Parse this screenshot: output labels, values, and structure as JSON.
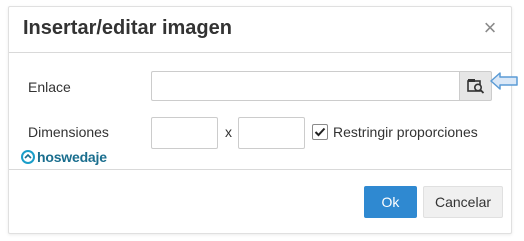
{
  "dialog": {
    "title": "Insertar/editar imagen",
    "close_glyph": "×"
  },
  "link": {
    "label": "Enlace",
    "value": "",
    "browse_icon": "image-browse-icon"
  },
  "dimensions": {
    "label": "Dimensiones",
    "width_value": "",
    "height_value": "",
    "separator": "x",
    "constrain_label": "Restringir proporciones",
    "constrain_checked": true
  },
  "watermark": {
    "text": "hoswedaje"
  },
  "footer": {
    "ok_label": "Ok",
    "cancel_label": "Cancelar"
  },
  "colors": {
    "primary": "#2f89d1",
    "arrow": "#5b9bd5"
  }
}
